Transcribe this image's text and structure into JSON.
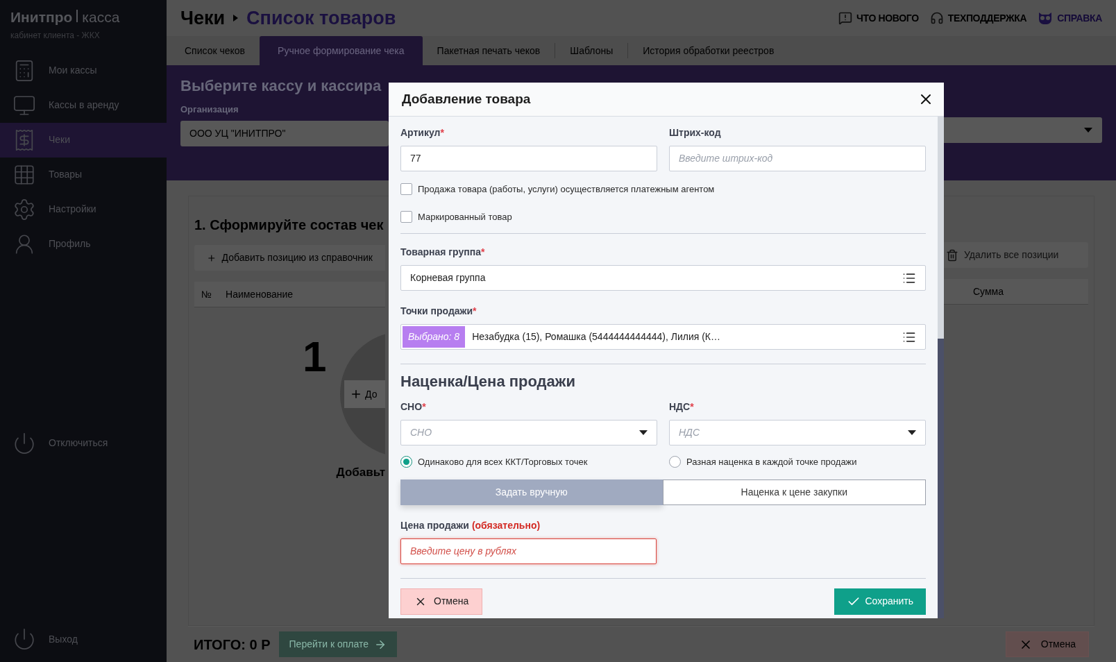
{
  "sidebar": {
    "brand": "Инитпро",
    "product": "касса",
    "subtitle": "кабинет клиента - ЖКХ",
    "items": [
      {
        "label": "Мои кассы",
        "selected": false
      },
      {
        "label": "Кассы в аренду",
        "selected": false
      },
      {
        "label": "Чеки",
        "selected": true
      },
      {
        "label": "Товары",
        "selected": false
      },
      {
        "label": "Настройки",
        "selected": false
      },
      {
        "label": "Профиль",
        "selected": false
      }
    ],
    "disconnect": "Отключиться",
    "logout": "Выход"
  },
  "header": {
    "breadcrumb": [
      {
        "label": "Чеки",
        "current": false
      },
      {
        "label": "Список товаров",
        "current": true
      }
    ],
    "links": [
      {
        "label": "ЧТО НОВОГО",
        "highlight": false
      },
      {
        "label": "ТЕХПОДДЕРЖКА",
        "highlight": false
      },
      {
        "label": "СПРАВКА",
        "highlight": true
      }
    ]
  },
  "tabs": [
    {
      "label": "Список чеков",
      "selected": false
    },
    {
      "label": "Ручное формирование чека",
      "selected": true
    },
    {
      "label": "Пакетная печать чеков",
      "selected": false
    },
    {
      "label": "Шаблоны",
      "selected": false
    },
    {
      "label": "История обработки реестров",
      "selected": false
    }
  ],
  "cashier_panel": {
    "title": "Выберите кассу и кассира",
    "org_label": "Организация",
    "org_value": "ООО УЦ \"ИНИТПРО\""
  },
  "receipt": {
    "heading": "1. Сформируйте состав чек",
    "add_button": "Добавить позицию из справочник",
    "delete_all_button": "Удалить все позиции",
    "columns": [
      "№",
      "Наименование",
      "Сумма"
    ],
    "step_number": "1",
    "circle_button": "До",
    "hint": "Добавьт",
    "total": "ИТОГО: 0 Р",
    "pay_button": "Перейти к оплате",
    "cancel_button": "Отмена"
  },
  "modal": {
    "title": "Добавление товара",
    "article": {
      "label": "Артикул",
      "required_mark": "*",
      "value": "77"
    },
    "barcode": {
      "label": "Штрих-код",
      "placeholder": "Введите штрих-код"
    },
    "options": [
      {
        "label": "Продажа товара (работы, услуги) осуществляется платежным агентом",
        "checked": false
      },
      {
        "label": "Маркированный товар",
        "checked": false
      }
    ],
    "product_group": {
      "label": "Товарная группа",
      "required_mark": "*",
      "value": "Корневая группа"
    },
    "sale_points": {
      "label": "Точки продажи",
      "required_mark": "*",
      "badge": "Выбрано: 8",
      "value": "Незабудка (15), Ромашка (5444444444444), Лилия (К…"
    },
    "pricing_title": "Наценка/Цена продажи",
    "tax_system": {
      "label": "СНО",
      "required_mark": "*",
      "placeholder": "СНО"
    },
    "vat": {
      "label": "НДС",
      "required_mark": "*",
      "placeholder": "НДС"
    },
    "markup_modes": [
      {
        "label": "Одинаково для всех ККТ/Торговых точек",
        "selected": true
      },
      {
        "label": "Разная наценка в каждой точке продажи",
        "selected": false
      }
    ],
    "price_modes": [
      {
        "label": "Задать вручную",
        "selected": true
      },
      {
        "label": "Наценка к цене закупки",
        "selected": false
      }
    ],
    "sale_price": {
      "label": "Цена продажи",
      "note": "(обязательно)",
      "placeholder": "Введите цену в рублях",
      "invalid": true
    },
    "buttons": [
      {
        "kind": "cancel",
        "label": "Отмена"
      },
      {
        "kind": "save",
        "label": "Сохранить"
      }
    ]
  }
}
